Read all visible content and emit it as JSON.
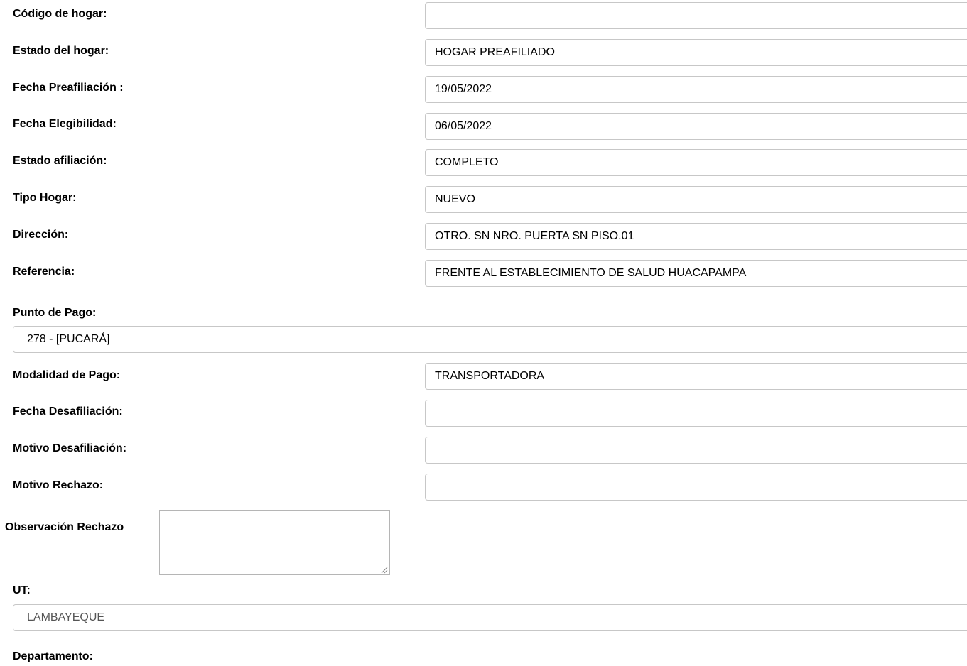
{
  "form": {
    "codigo_hogar": {
      "label": "Código de hogar:",
      "value": ""
    },
    "estado_hogar": {
      "label": "Estado del hogar:",
      "value": "HOGAR PREAFILIADO"
    },
    "fecha_preafiliacion": {
      "label": "Fecha Preafiliación :",
      "value": "19/05/2022"
    },
    "fecha_elegibilidad": {
      "label": "Fecha Elegibilidad:",
      "value": "06/05/2022"
    },
    "estado_afiliacion": {
      "label": "Estado afiliación:",
      "value": "COMPLETO"
    },
    "tipo_hogar": {
      "label": "Tipo Hogar:",
      "value": "NUEVO"
    },
    "direccion": {
      "label": "Dirección:",
      "value": "OTRO. SN NRO. PUERTA SN PISO.01"
    },
    "referencia": {
      "label": "Referencia:",
      "value": "FRENTE AL ESTABLECIMIENTO DE SALUD HUACAPAMPA"
    },
    "punto_pago": {
      "label": "Punto de Pago:",
      "selected": "278 - [PUCARÁ]"
    },
    "modalidad_pago": {
      "label": "Modalidad de Pago:",
      "value": "TRANSPORTADORA"
    },
    "fecha_desafiliacion": {
      "label": "Fecha Desafiliación:",
      "value": ""
    },
    "motivo_desafiliacion": {
      "label": "Motivo Desafiliación:",
      "value": ""
    },
    "motivo_rechazo": {
      "label": "Motivo Rechazo:",
      "value": ""
    },
    "observacion_rechazo": {
      "label": "Observación Rechazo",
      "value": ""
    },
    "ut": {
      "label": "UT:",
      "selected": "LAMBAYEQUE"
    },
    "departamento": {
      "label": "Departamento:"
    }
  },
  "icons": {
    "select_arrow": "chevron-down-icon",
    "resize_grip": "resize-grip-icon"
  }
}
